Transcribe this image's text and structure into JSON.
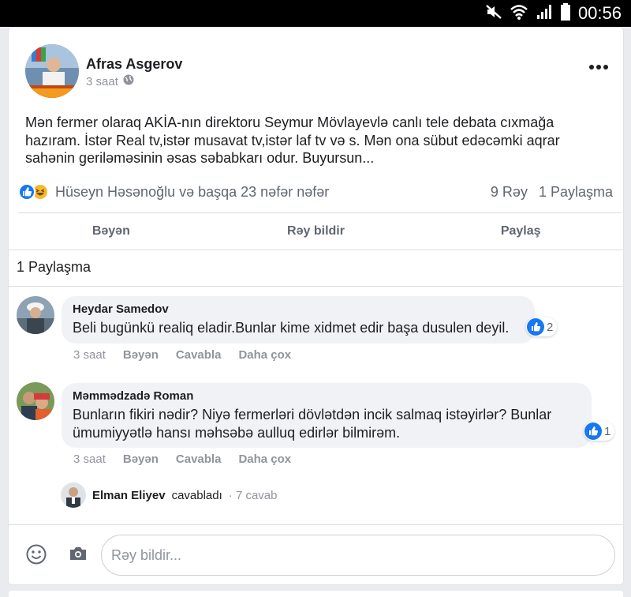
{
  "status_bar": {
    "time": "00:56"
  },
  "post": {
    "author": "Afras Asgerov",
    "time": "3 saat",
    "text": "Mən fermer olaraq AKİA-nın direktoru Seymur Mövlayevlə canlı tele debata cıxmağa hazıram. İstər Real tv,istər musavat tv,istər laf tv və s. Mən ona sübut edəcəmki aqrar sahənin geriləməsinin əsas səbabkarı odur. Buyursun...",
    "reactions_text": "Hüseyn Həsənoğlu və başqa 23 nəfər nəfər",
    "comments_count": "9 Rəy",
    "shares_count": "1 Paylaşma"
  },
  "actions": {
    "like": "Bəyən",
    "comment": "Rəy bildir",
    "share": "Paylaş"
  },
  "shares_line": "1 Paylaşma",
  "comments": [
    {
      "name": "Heydar Samedov",
      "text": "Beli bugünkü realiq eladir.Bunlar kime xidmet edir başa dusulen deyil.",
      "reaction_count": "2",
      "time": "3 saat",
      "like": "Bəyən",
      "reply": "Cavabla",
      "more": "Daha çox"
    },
    {
      "name": "Məmmədzadə Roman",
      "text": "Bunların fikiri nədir? Niyə fermerləri dövlətdən incik salmaq istəyirlər? Bunlar ümumiyyətlə hansı məhsəbə aulluq edirlər bilmirəm.",
      "reaction_count": "1",
      "time": "3 saat",
      "like": "Bəyən",
      "reply": "Cavabla",
      "more": "Daha çox"
    }
  ],
  "reply_summary": {
    "name": "Elman Eliyev",
    "verb": "cavabladı",
    "count": "· 7 cavab"
  },
  "composer": {
    "placeholder": "Rəy bildir..."
  },
  "colors": {
    "accent": "#1877f2",
    "haha": "#f7b928",
    "secondary_text": "#606770"
  }
}
